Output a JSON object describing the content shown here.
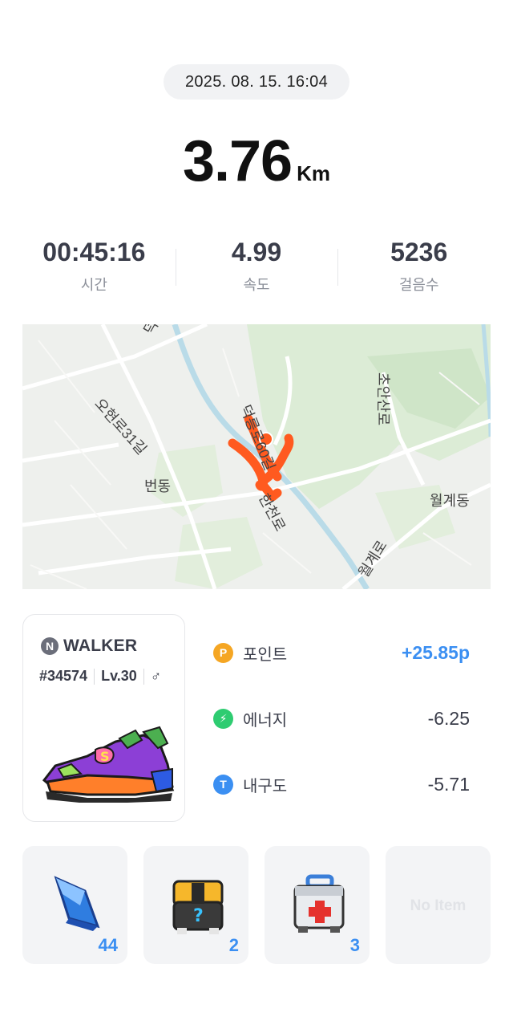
{
  "date": "2025. 08. 15. 16:04",
  "distance": {
    "value": "3.76",
    "unit": "Km"
  },
  "stats": [
    {
      "value": "00:45:16",
      "label": "시간"
    },
    {
      "value": "4.99",
      "label": "속도"
    },
    {
      "value": "5236",
      "label": "걸음수"
    }
  ],
  "map": {
    "labels": [
      "오현로31길",
      "번동",
      "덕릉로60길",
      "한천로",
      "초안산로",
      "월계동",
      "월계로",
      "덕"
    ],
    "route_color": "#ff5a1f"
  },
  "nft": {
    "logo_letter": "N",
    "brand": "WALKER",
    "id": "#34574",
    "level": "Lv.30",
    "gender_symbol": "♂"
  },
  "rewards": [
    {
      "icon": "point-icon",
      "icon_letter": "P",
      "color": "#f5a623",
      "label": "포인트",
      "value": "+25.85p"
    },
    {
      "icon": "energy-icon",
      "icon_letter": "⚡",
      "color": "#2ecc71",
      "label": "에너지",
      "value": "-6.25"
    },
    {
      "icon": "durability-icon",
      "icon_letter": "T",
      "color": "#3b8ff2",
      "label": "내구도",
      "value": "-5.71"
    }
  ],
  "items": [
    {
      "name": "blue-crystal-icon",
      "count": "44"
    },
    {
      "name": "mystery-box-icon",
      "count": "2"
    },
    {
      "name": "repair-kit-icon",
      "count": "3"
    },
    {
      "name": "empty-slot",
      "empty_text": "No Item"
    }
  ],
  "colors": {
    "accent": "#3b8ff2",
    "text": "#3a3d4a",
    "muted": "#8b8f99"
  }
}
